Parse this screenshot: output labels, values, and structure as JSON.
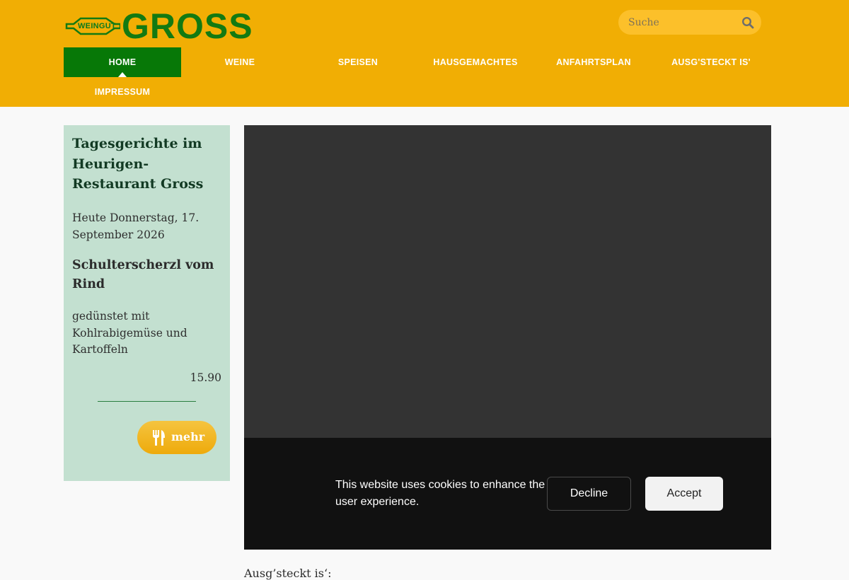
{
  "header": {
    "logo_badge": "WEINGUT",
    "logo_word": "GROSS",
    "search_placeholder": "Suche",
    "search_icon": "search-icon",
    "background_color": "#f1ae04"
  },
  "nav": {
    "items": [
      {
        "label": "HOME",
        "active": true
      },
      {
        "label": "WEINE"
      },
      {
        "label": "SPEISEN"
      },
      {
        "label": "HAUSGEMACHTES"
      },
      {
        "label": "ANFAHRTSPLAN"
      },
      {
        "label": "AUSG'STECKT IS'"
      },
      {
        "label": "IMPRESSUM"
      }
    ],
    "active_color": "#077807"
  },
  "sidebar": {
    "title": "Tagesgerichte im Heurigen-Restaurant Gross",
    "date": "Heute Donnerstag, 17. September 2026",
    "dish": "Schulterscherzl vom Rind",
    "description": "gedünstet mit Kohlrabigemüse und Kartoffeln",
    "price": "15.90",
    "more_label": "mehr",
    "more_icon": "cutlery-icon",
    "background_color": "#c3e0d0"
  },
  "cookie": {
    "message": "This website uses cookies to enhance the user experience.",
    "decline_label": "Decline",
    "accept_label": "Accept"
  },
  "main": {
    "section_heading": "Ausg’steckt is‘:"
  }
}
